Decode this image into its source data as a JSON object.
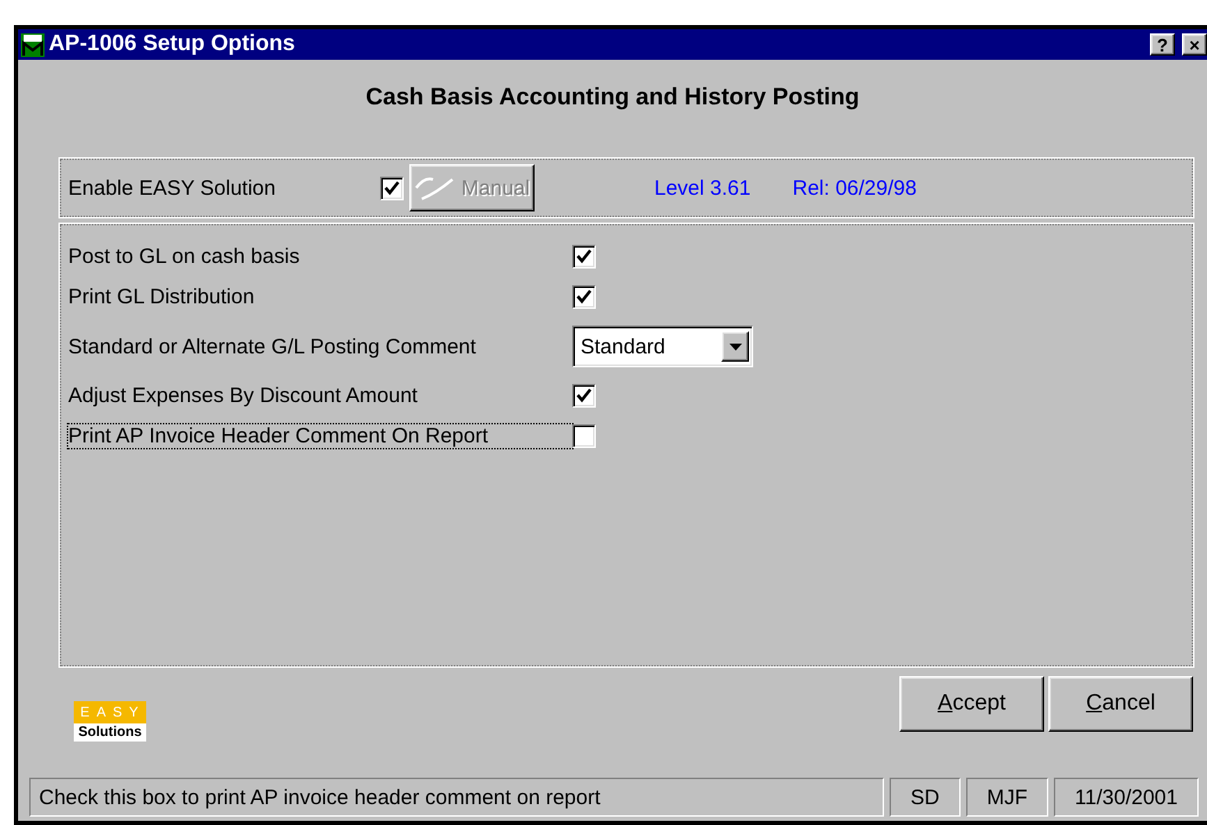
{
  "window": {
    "title": "AP-1006 Setup Options",
    "buttons": [
      "?",
      "×"
    ]
  },
  "heading": "Cash Basis Accounting and History Posting",
  "easy": {
    "label": "Enable EASY Solution",
    "checked": true,
    "manual_button": {
      "label": "Manual",
      "disabled": true
    },
    "level": "Level 3.61",
    "release": "Rel: 06/29/98"
  },
  "options": [
    {
      "kind": "check",
      "label": "Post to GL on cash basis",
      "checked": true,
      "focused": false
    },
    {
      "kind": "check",
      "label": "Print GL Distribution",
      "checked": true,
      "focused": false
    },
    {
      "kind": "select",
      "label": "Standard or Alternate G/L Posting Comment",
      "value": "Standard",
      "focused": false
    },
    {
      "kind": "check",
      "label": "Adjust Expenses By Discount Amount",
      "checked": true,
      "focused": false
    },
    {
      "kind": "check",
      "label": "Print AP Invoice Header Comment On Report",
      "checked": false,
      "focused": true
    }
  ],
  "logo": {
    "top": "EASY",
    "bottom": "Solutions"
  },
  "buttons": [
    {
      "label": "Accept"
    },
    {
      "label": "Cancel"
    }
  ],
  "status_bar": [
    "Check this box to print AP invoice header comment on report",
    "SD",
    "MJF",
    "11/30/2001"
  ]
}
